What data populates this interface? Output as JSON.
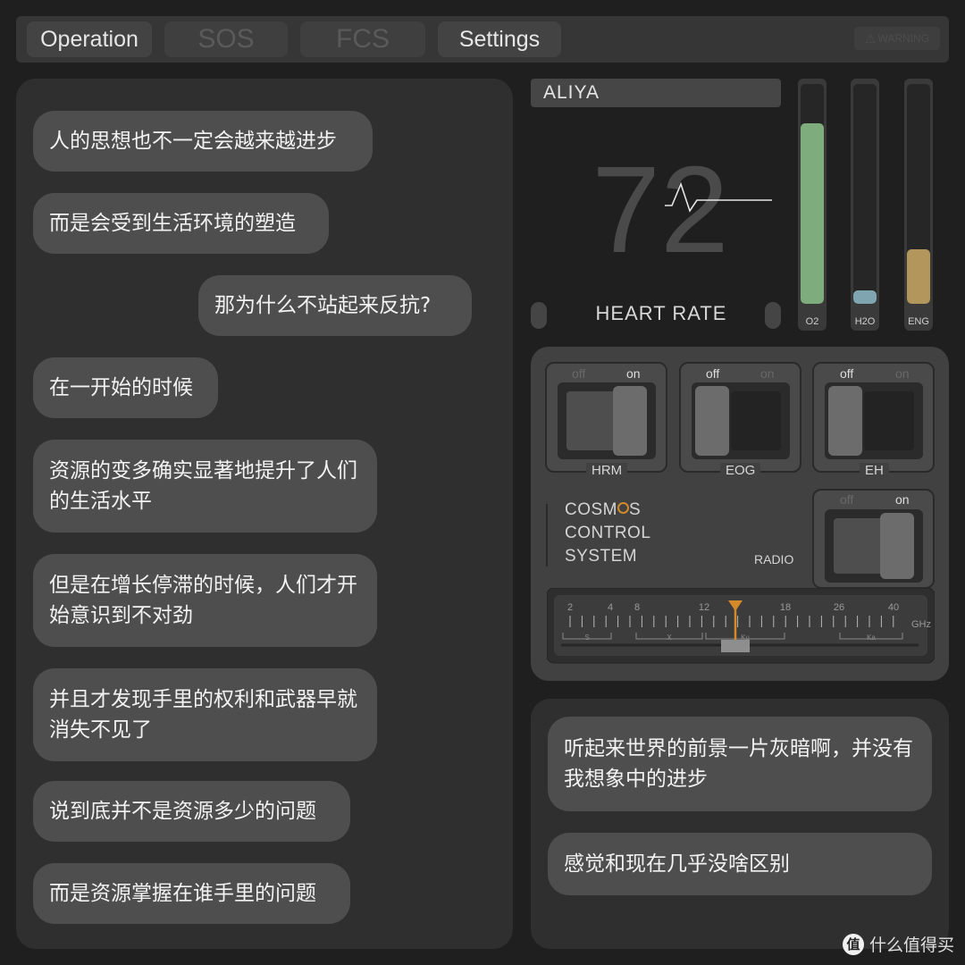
{
  "tabs": [
    {
      "label": "Operation",
      "enabled": true
    },
    {
      "label": "SOS",
      "enabled": false
    },
    {
      "label": "FCS",
      "enabled": false
    },
    {
      "label": "Settings",
      "enabled": true
    }
  ],
  "warning_label": "WARNING",
  "left_chat": [
    "人的思想也不一定会越来越进步",
    "而是会受到生活环境的塑造",
    "那为什么不站起来反抗?",
    "在一开始的时候",
    "资源的变多确实显著地提升了人们的生活水平",
    "但是在增长停滞的时候，人们才开始意识到不对劲",
    "并且才发现手里的权利和武器早就消失不见了",
    "说到底并不是资源多少的问题",
    "而是资源掌握在谁手里的问题"
  ],
  "vitals": {
    "name": "ALIYA",
    "heart_rate_value": "72",
    "heart_rate_label": "HEART RATE",
    "gauges": [
      {
        "label": "O2",
        "level": 0.82,
        "color": "#7fac7c"
      },
      {
        "label": "H2O",
        "level": 0.06,
        "color": "#7ea5b0"
      },
      {
        "label": "ENG",
        "level": 0.25,
        "color": "#b3965c"
      }
    ]
  },
  "controls": {
    "off_label": "off",
    "on_label": "on",
    "switches": [
      {
        "name": "HRM",
        "state": "on"
      },
      {
        "name": "EOG",
        "state": "off"
      },
      {
        "name": "EH",
        "state": "off"
      }
    ],
    "system_name": [
      "COSMOS",
      "CONTROL",
      "SYSTEM"
    ],
    "radio": {
      "name": "RADIO",
      "state": "on"
    },
    "tuner": {
      "scale_labels": [
        "2",
        "4",
        "8",
        "12",
        "18",
        "26",
        "40"
      ],
      "unit": "GHz",
      "bands": [
        "S",
        "X",
        "Ku",
        "Ka"
      ]
    }
  },
  "right_chat": [
    "听起来世界的前景一片灰暗啊，并没有我想象中的进步",
    "感觉和现在几乎没啥区别"
  ],
  "watermark": {
    "logo": "值",
    "text": "什么值得买"
  }
}
